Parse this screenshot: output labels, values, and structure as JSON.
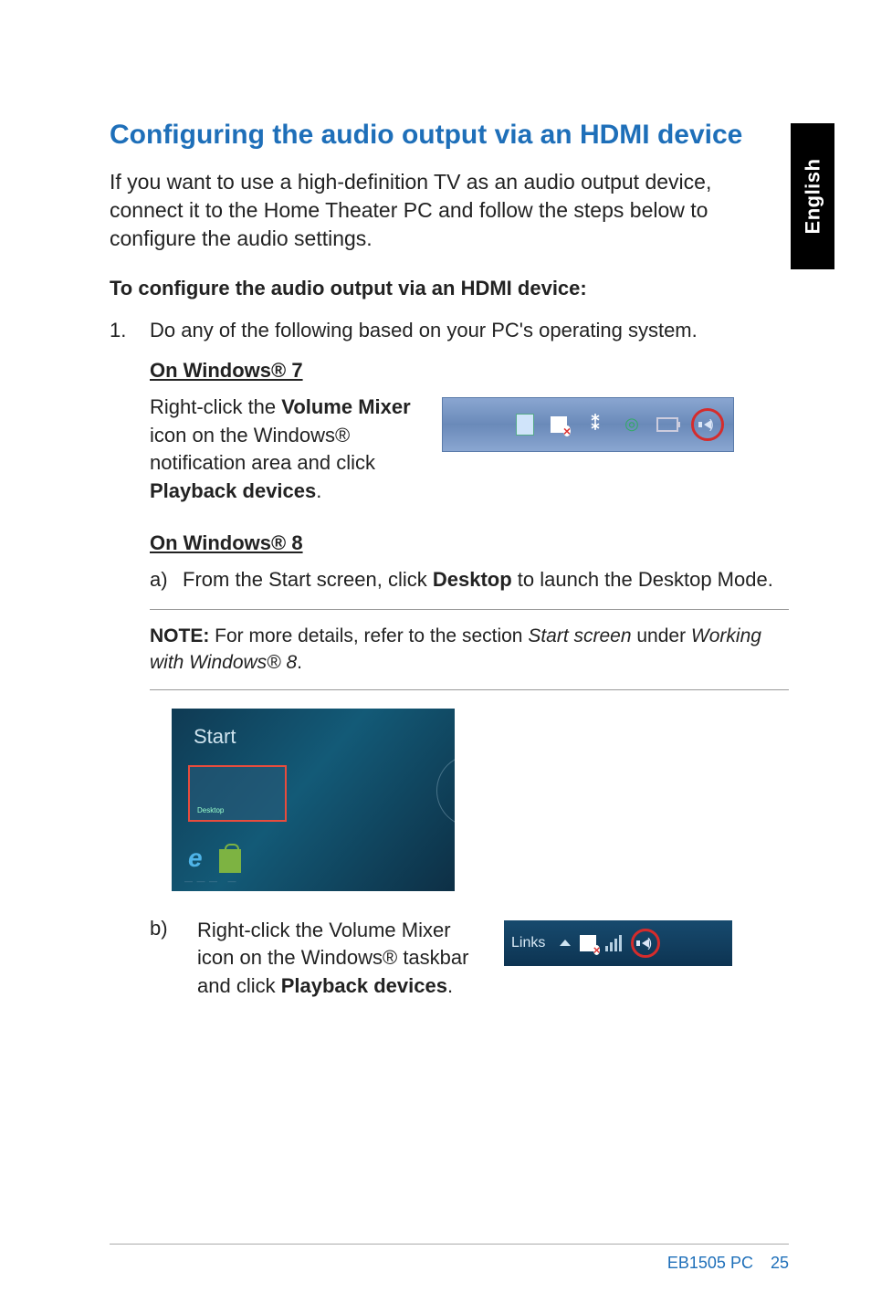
{
  "side_tab": "English",
  "title": "Configuring the audio output via an HDMI device",
  "intro": "If you want to use a high-definition TV as an audio output device, connect it to the Home Theater PC and follow the steps below to configure the audio settings.",
  "sub1": "To configure the audio output via an HDMI device:",
  "step1_marker": "1.",
  "step1_text": "Do any of the following based on your PC's operating system.",
  "win7_heading": "On Windows® 7",
  "win7_text_pre": "Right-click the ",
  "win7_bold1": "Volume Mixer",
  "win7_text_mid": " icon on the Windows® notification area and click ",
  "win7_bold2": "Playback devices",
  "win7_text_post": ".",
  "win8_heading": "On Windows® 8",
  "win8_a_marker": "a)",
  "win8_a_pre": "From the Start screen, click ",
  "win8_a_bold": "Desktop",
  "win8_a_post": " to launch the Desktop Mode.",
  "note_label": "NOTE:",
  "note_pre": "   For more details, refer to the section ",
  "note_it1": "Start screen",
  "note_mid": " under ",
  "note_it2": "Working with Windows® 8",
  "note_post": ".",
  "start_label": "Start",
  "tile_tiny": "Desktop",
  "win8_b_marker": "b)",
  "win8_b_pre": "Right-click the Volume Mixer icon on the Windows® taskbar and click ",
  "win8_b_bold": "Playback devices",
  "win8_b_post": ".",
  "tray2_links": "Links",
  "footer_model": "EB1505 PC",
  "footer_page": "25"
}
